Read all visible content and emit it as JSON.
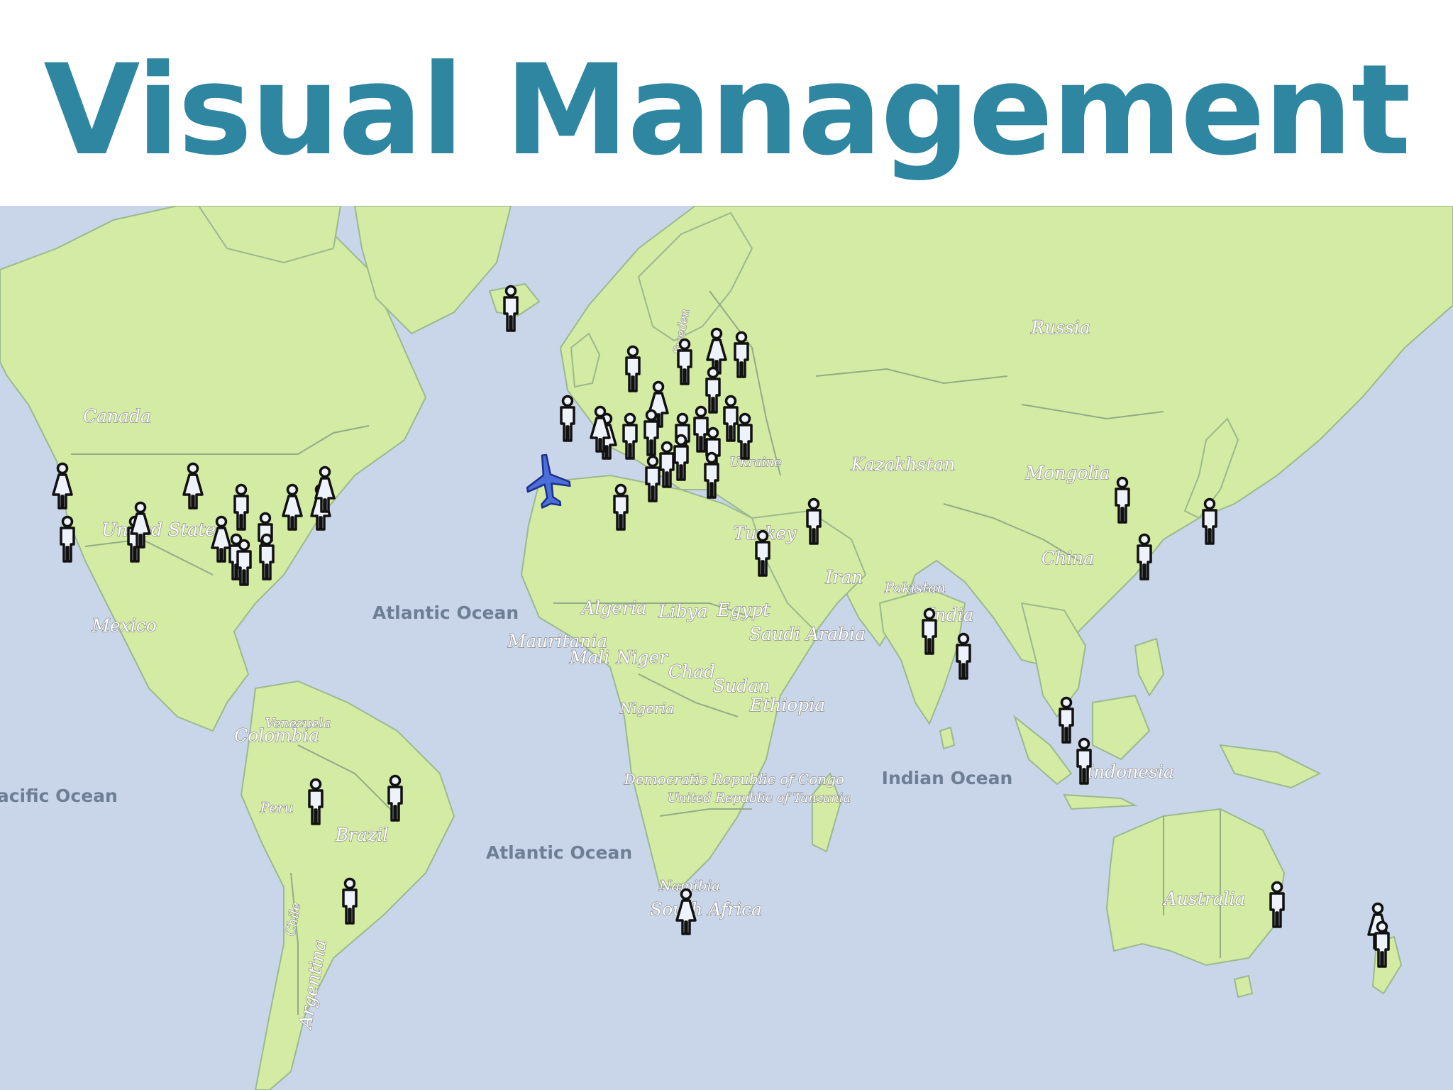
{
  "title": "Visual Management",
  "colors": {
    "title": "#2f86a0",
    "ocean": "#c9d6ea",
    "land": "#d3eba3",
    "border": "#93ab86",
    "marker_fill": "#eef3fb"
  },
  "map": {
    "countries": [
      "Canada",
      "United States",
      "Mexico",
      "Venezuela",
      "Colombia",
      "Peru",
      "Brazil",
      "Chile",
      "Argentina",
      "Russia",
      "Kazakhstan",
      "Mongolia",
      "China",
      "Turkey",
      "Iran",
      "Pakistan",
      "India",
      "Algeria",
      "Libya",
      "Egypt",
      "Saudi Arabia",
      "Mauritania",
      "Mali",
      "Niger",
      "Chad",
      "Sudan",
      "Ethiopia",
      "Nigeria",
      "Democratic Republic of Congo",
      "United Republic of Tanzania",
      "Namibia",
      "South Africa",
      "Indonesia",
      "Australia",
      "Sweden",
      "Ukraine"
    ],
    "oceans": [
      "Atlantic Ocean",
      "Atlantic Ocean",
      "Pacific Ocean",
      "Indian Ocean"
    ],
    "icons": [
      "person-marker-icon",
      "female-marker-icon",
      "airplane-icon"
    ]
  }
}
